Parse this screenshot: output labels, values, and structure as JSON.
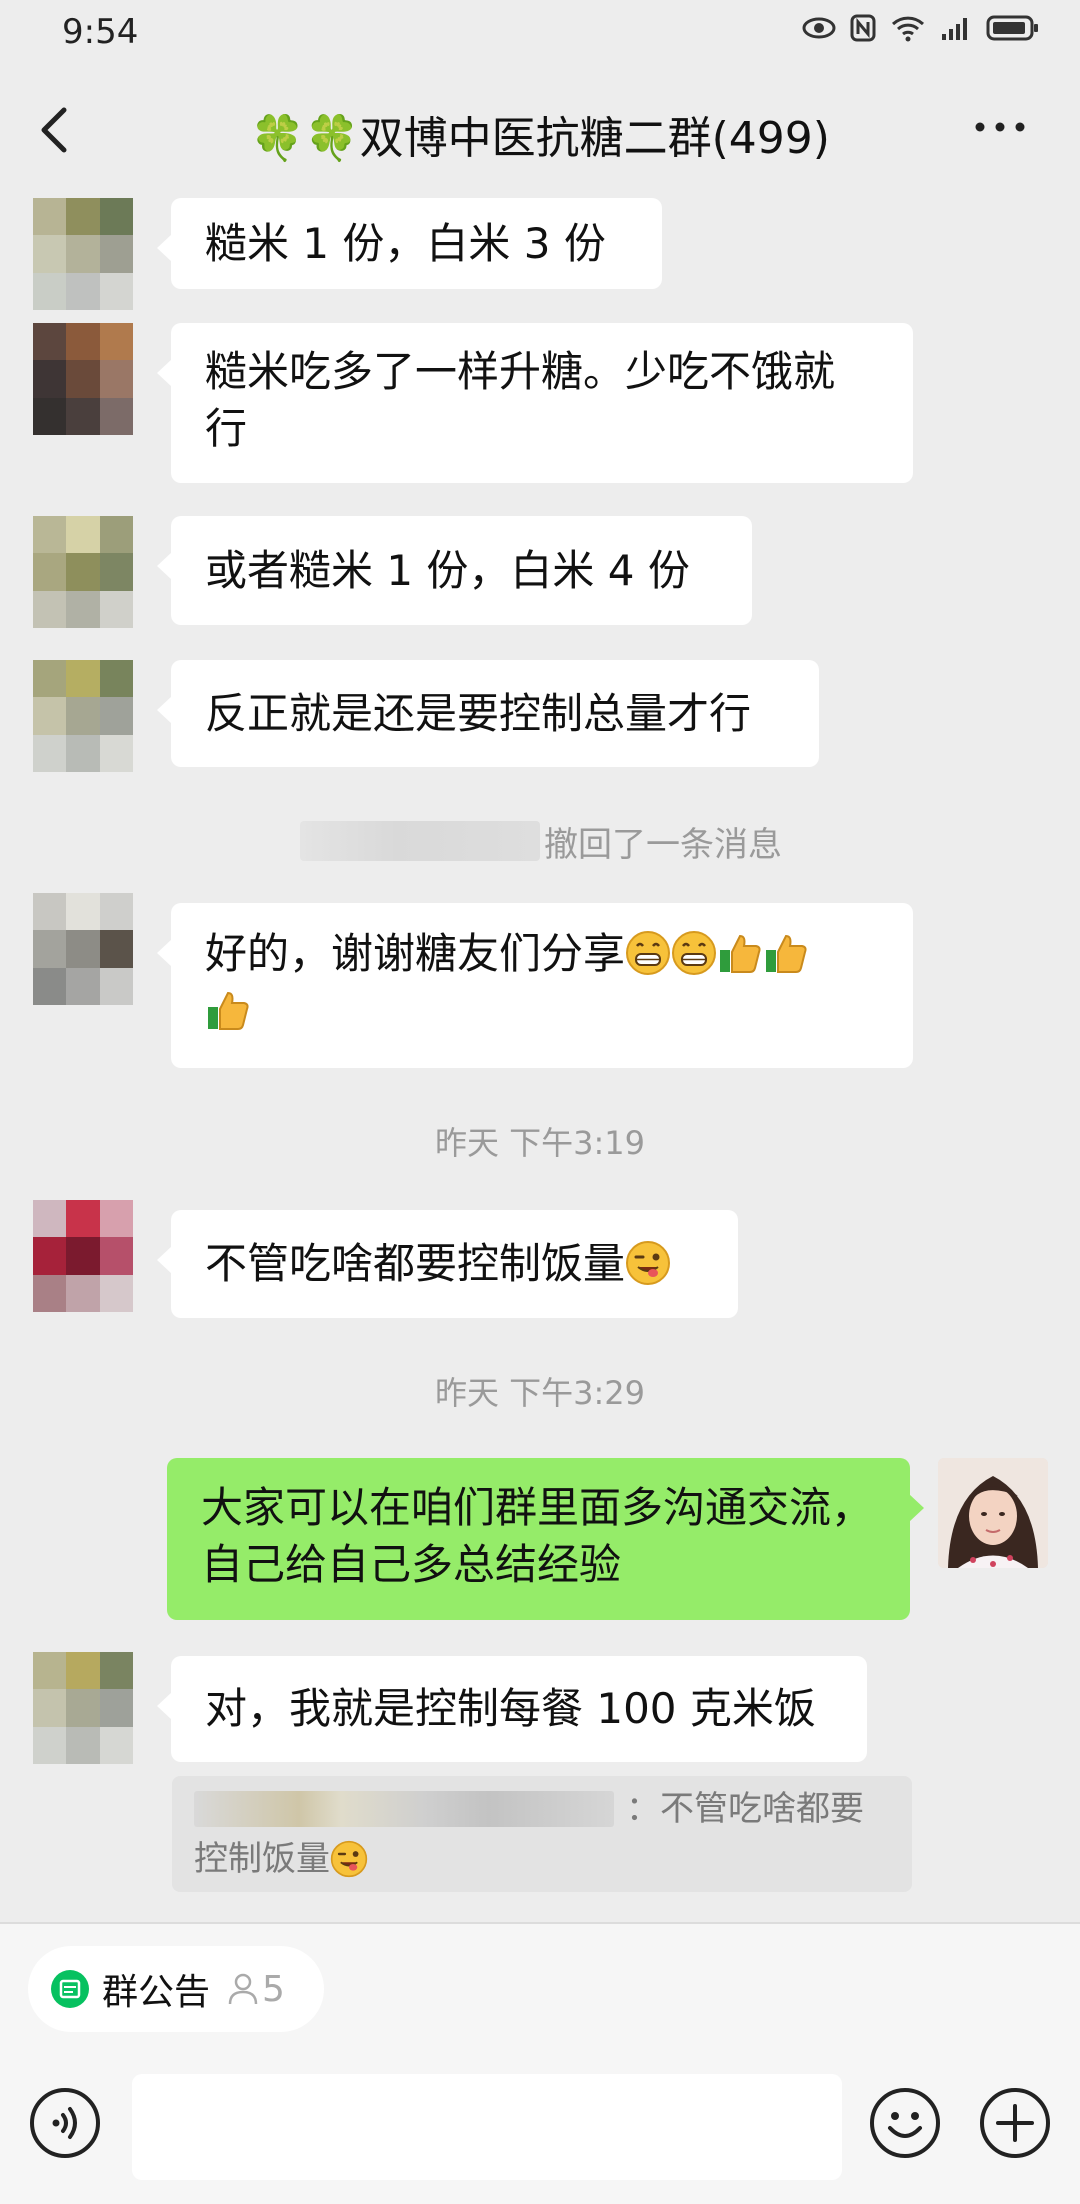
{
  "status": {
    "time": "9:54"
  },
  "header": {
    "title": "🍀🍀双博中医抗糖二群(499)"
  },
  "messages": {
    "m1": "糙米 1 份，白米 3 份",
    "m2a": "糙米吃多了一样升糖。少吃不饿就",
    "m2b": "行",
    "m3": "或者糙米 1 份，白米 4 份",
    "m4": "反正就是还是要控制总量才行",
    "recall": "撤回了一条消息",
    "m5a": "好的，谢谢糖友们分享",
    "time1": "昨天 下午3:19",
    "m6": "不管吃啥都要控制饭量",
    "time2": "昨天 下午3:29",
    "m7a": "大家可以在咱们群里面多沟通交流，",
    "m7b": "自己给自己多总结经验",
    "m8": "对，我就是控制每餐 100 克米饭",
    "quote_a": "：不管吃啥都要",
    "quote_b": "控制饭量"
  },
  "bottom": {
    "notice_label": "群公告",
    "notice_count": "5"
  },
  "icons": [
    "back-icon",
    "more-icon",
    "eye-icon",
    "nfc-icon",
    "wifi-icon",
    "signal-icon",
    "battery-icon",
    "voice-icon",
    "emoji-icon",
    "plus-icon",
    "grin-emoji-icon",
    "thumbs-up-emoji-icon",
    "wink-emoji-icon",
    "announcement-icon",
    "person-icon"
  ],
  "colors": {
    "background": "#ededed",
    "my_bubble": "#95ec69",
    "other_bubble": "#ffffff"
  }
}
